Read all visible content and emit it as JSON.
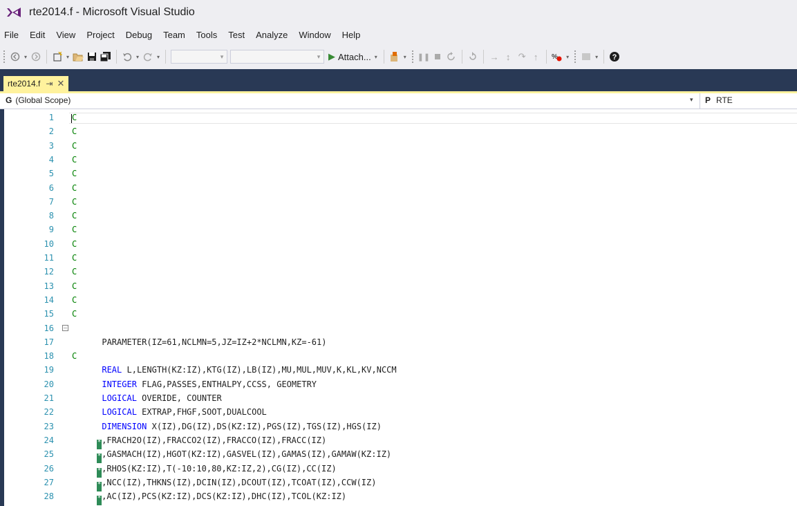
{
  "window": {
    "title": "rte2014.f - Microsoft Visual Studio"
  },
  "menu": [
    "File",
    "Edit",
    "View",
    "Project",
    "Debug",
    "Team",
    "Tools",
    "Test",
    "Analyze",
    "Window",
    "Help"
  ],
  "toolbar": {
    "attach_label": "Attach..."
  },
  "tab": {
    "label": "rte2014.f",
    "pin_glyph": "⇥",
    "close_glyph": "✕"
  },
  "navbar": {
    "scope_icon": "G",
    "scope": "(Global Scope)",
    "member_icon": "P",
    "member": "RTE"
  },
  "editor": {
    "lines": [
      {
        "n": "1",
        "indent": "",
        "segments": [
          {
            "t": "C",
            "c": "comment"
          }
        ]
      },
      {
        "n": "2",
        "indent": "",
        "segments": [
          {
            "t": "C",
            "c": "comment"
          }
        ]
      },
      {
        "n": "3",
        "indent": "",
        "segments": [
          {
            "t": "C",
            "c": "comment"
          }
        ]
      },
      {
        "n": "4",
        "indent": "",
        "segments": [
          {
            "t": "C",
            "c": "comment"
          }
        ]
      },
      {
        "n": "5",
        "indent": "",
        "segments": [
          {
            "t": "C",
            "c": "comment"
          }
        ]
      },
      {
        "n": "6",
        "indent": "",
        "segments": [
          {
            "t": "C",
            "c": "comment"
          }
        ]
      },
      {
        "n": "7",
        "indent": "",
        "segments": [
          {
            "t": "C",
            "c": "comment"
          }
        ]
      },
      {
        "n": "8",
        "indent": "",
        "segments": [
          {
            "t": "C",
            "c": "comment"
          }
        ]
      },
      {
        "n": "9",
        "indent": "",
        "segments": [
          {
            "t": "C",
            "c": "comment"
          }
        ]
      },
      {
        "n": "10",
        "indent": "",
        "segments": [
          {
            "t": "C",
            "c": "comment"
          }
        ]
      },
      {
        "n": "11",
        "indent": "",
        "segments": [
          {
            "t": "C",
            "c": "comment"
          }
        ]
      },
      {
        "n": "12",
        "indent": "",
        "segments": [
          {
            "t": "C",
            "c": "comment"
          }
        ]
      },
      {
        "n": "13",
        "indent": "",
        "segments": [
          {
            "t": "C",
            "c": "comment"
          }
        ]
      },
      {
        "n": "14",
        "indent": "",
        "segments": [
          {
            "t": "C",
            "c": "comment"
          }
        ]
      },
      {
        "n": "15",
        "indent": "",
        "segments": [
          {
            "t": "C",
            "c": "comment"
          }
        ]
      },
      {
        "n": "16",
        "fold": true,
        "indent": "",
        "segments": []
      },
      {
        "n": "17",
        "indent": "      ",
        "segments": [
          {
            "t": "PARAMETER(IZ=61,NCLMN=5,JZ=IZ+2*NCLMN,KZ=-61)",
            "c": "plain"
          }
        ]
      },
      {
        "n": "18",
        "indent": "",
        "segments": [
          {
            "t": "C",
            "c": "comment"
          }
        ]
      },
      {
        "n": "19",
        "indent": "      ",
        "segments": [
          {
            "t": "REAL",
            "c": "kw"
          },
          {
            "t": " L,LENGTH(KZ:IZ),KTG(IZ),LB(IZ),MU,MUL,MUV,K,KL,KV,NCCM",
            "c": "plain"
          }
        ]
      },
      {
        "n": "20",
        "indent": "      ",
        "segments": [
          {
            "t": "INTEGER",
            "c": "kw"
          },
          {
            "t": " FLAG,PASSES,ENTHALPY,CCSS, GEOMETRY",
            "c": "plain"
          }
        ]
      },
      {
        "n": "21",
        "indent": "      ",
        "segments": [
          {
            "t": "LOGICAL",
            "c": "kw"
          },
          {
            "t": " OVERIDE, COUNTER",
            "c": "plain"
          }
        ]
      },
      {
        "n": "22",
        "indent": "      ",
        "segments": [
          {
            "t": "LOGICAL",
            "c": "kw"
          },
          {
            "t": " EXTRAP,FHGF,SOOT,DUALCOOL",
            "c": "plain"
          }
        ]
      },
      {
        "n": "23",
        "indent": "      ",
        "segments": [
          {
            "t": "DIMENSION",
            "c": "kw"
          },
          {
            "t": " X(IZ),DG(IZ),DS(KZ:IZ),PGS(IZ),TGS(IZ),HGS(IZ)",
            "c": "plain"
          }
        ]
      },
      {
        "n": "24",
        "cont": true,
        "indent": "     ",
        "segments": [
          {
            "t": ",FRACH2O(IZ),FRACCO2(IZ),FRACCO(IZ),FRACC(IZ)",
            "c": "plain"
          }
        ]
      },
      {
        "n": "25",
        "cont": true,
        "indent": "     ",
        "segments": [
          {
            "t": ",GASMACH(IZ),HGOT(KZ:IZ),GASVEL(IZ),GAMAS(IZ),GAMAW(KZ:IZ)",
            "c": "plain"
          }
        ]
      },
      {
        "n": "26",
        "cont": true,
        "indent": "     ",
        "segments": [
          {
            "t": ",RHOS(KZ:IZ),T(-10:10,80,KZ:IZ,2),CG(IZ),CC(IZ)",
            "c": "plain"
          }
        ]
      },
      {
        "n": "27",
        "cont": true,
        "indent": "     ",
        "segments": [
          {
            "t": ",NCC(IZ),THKNS(IZ),DCIN(IZ),DCOUT(IZ),TCOAT(IZ),CCW(IZ)",
            "c": "plain"
          }
        ]
      },
      {
        "n": "28",
        "cont": true,
        "indent": "     ",
        "segments": [
          {
            "t": ",AC(IZ),PCS(KZ:IZ),DCS(KZ:IZ),DHC(IZ),TCOL(KZ:IZ)",
            "c": "plain"
          }
        ]
      }
    ]
  }
}
